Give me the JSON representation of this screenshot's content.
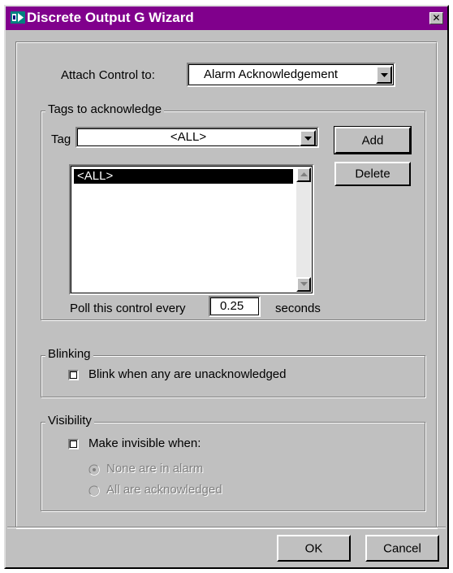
{
  "window": {
    "title": "Discrete Output G Wizard",
    "close_glyph": "✕",
    "title_color": "#80008c"
  },
  "attach": {
    "label": "Attach Control to:",
    "value": "Alarm Acknowledgement"
  },
  "tags_group": {
    "title": "Tags to acknowledge",
    "tag_label": "Tag",
    "tag_value": "<ALL>",
    "add_label": "Add",
    "delete_label": "Delete",
    "list_items": [
      "<ALL>"
    ],
    "poll_label": "Poll this control every",
    "poll_value": "0.25",
    "poll_unit": "seconds"
  },
  "blinking_group": {
    "title": "Blinking",
    "checkbox_label": "Blink when any are unacknowledged",
    "checked": false
  },
  "visibility_group": {
    "title": "Visibility",
    "checkbox_label": "Make invisible when:",
    "checked": false,
    "radio_none_label": "None are in alarm",
    "radio_all_label": "All are acknowledged",
    "radio_selected": "None are in alarm"
  },
  "footer": {
    "ok_label": "OK",
    "cancel_label": "Cancel"
  },
  "icons": {
    "title": "wizard-app-icon",
    "dropdown": "triangle-down-icon",
    "scroll_up": "triangle-up-icon",
    "scroll_down": "triangle-down-icon"
  }
}
